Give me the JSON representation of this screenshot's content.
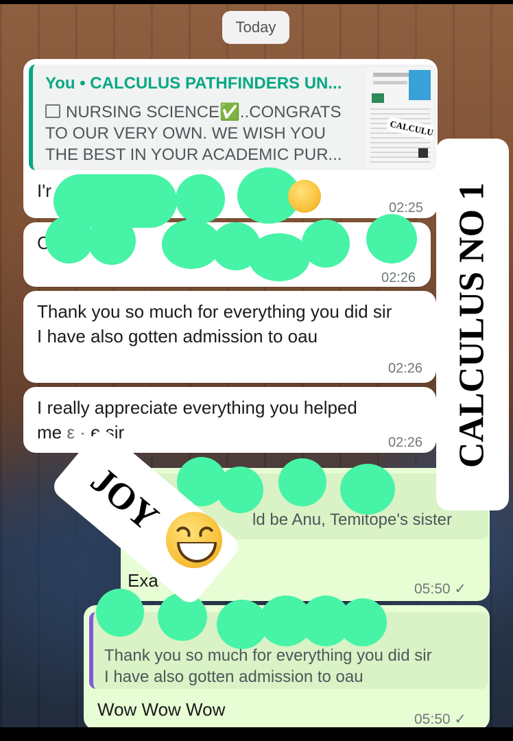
{
  "date_separator": "Today",
  "messages": {
    "m1": {
      "quote_author": "You • CALCULUS PATHFINDERS UN...",
      "quote_icon": "image-icon",
      "quote_text": "NURSING SCIENCE✅..CONGRATS TO OUR VERY OWN. WE WISH YOU THE BEST IN YOUR ACADEMIC PUR...",
      "thumb_label": "CALCULUS",
      "text": "I'r",
      "time": "02:25"
    },
    "m2": {
      "text": "C",
      "time": "02:26"
    },
    "m3": {
      "line1": "Thank you so much for everything you did sir",
      "line2": "I have also gotten admission to oau",
      "time": "02:26"
    },
    "m4": {
      "line1": "I really appreciate everything you helped",
      "line2": "me",
      "line2_tail": "e sir",
      "time": "02:26"
    },
    "m5": {
      "quote_text": "ld be Anu, Temitope's sister",
      "text": "Exa",
      "time": "05:50",
      "status": "✓"
    },
    "m6": {
      "quote_text": "Thank you so much for everything you did sir\nI have also gotten admission to oau",
      "text": "Wow Wow Wow",
      "time": "05:50",
      "status": "✓"
    }
  },
  "overlays": {
    "vertical_sticker": "CALCULUS NO 1",
    "joy_sticker": "JOY",
    "emoji_name": "grinning-squinting-face"
  },
  "colors": {
    "incoming": "#ffffff",
    "outgoing": "#e7fdd4",
    "accent": "#06a884",
    "censor": "#47f3a6"
  }
}
